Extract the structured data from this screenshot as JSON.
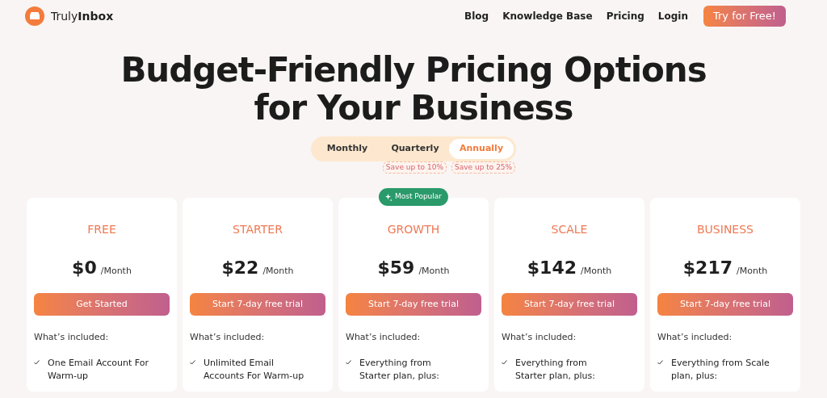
{
  "header": {
    "logo": "Truly**Inbox**",
    "nav": [
      "Blog",
      "Knowledge Base",
      "Pricing",
      "Login"
    ],
    "cta": "Try for Free!"
  },
  "hero": {
    "title_lines": [
      "Budget-Friendly Pricing Options",
      "for Your Business"
    ]
  },
  "billing": [
    {
      "label": "Monthly",
      "selected": false
    },
    {
      "label": "Quarterly",
      "selected": false,
      "badge": "Save up to 10%"
    },
    {
      "label": "Annually",
      "selected": true,
      "badge": "Save up to 25%"
    }
  ],
  "plans": [
    {
      "name": "FREE",
      "price": "$0",
      "period": "/Month",
      "button": "Get Started",
      "included": "What’s included:",
      "features": [
        "One Email Account For Warm-up"
      ]
    },
    {
      "name": "STARTER",
      "price": "$22",
      "period": "/Month",
      "button": "Start 7-day free trial",
      "included": "What’s included:",
      "features": [
        "Unlimited Email Accounts For Warm-up"
      ]
    },
    {
      "name": "GROWTH",
      "price": "$59",
      "period": "/Month",
      "button": "Start 7-day free trial",
      "included": "What’s included:",
      "features": [
        "Everything from Starter plan, plus:"
      ],
      "badge": "Most Popular"
    },
    {
      "name": "SCALE",
      "price": "$142",
      "period": "/Month",
      "button": "Start 7-day free trial",
      "included": "What’s included:",
      "features": [
        "Everything from Starter plan, plus:"
      ]
    },
    {
      "name": "BUSINESS",
      "price": "$217",
      "period": "/Month",
      "button": "Start 7-day free trial",
      "included": "What’s included:",
      "features": [
        "Everything from Scale plan, plus:"
      ]
    }
  ]
}
